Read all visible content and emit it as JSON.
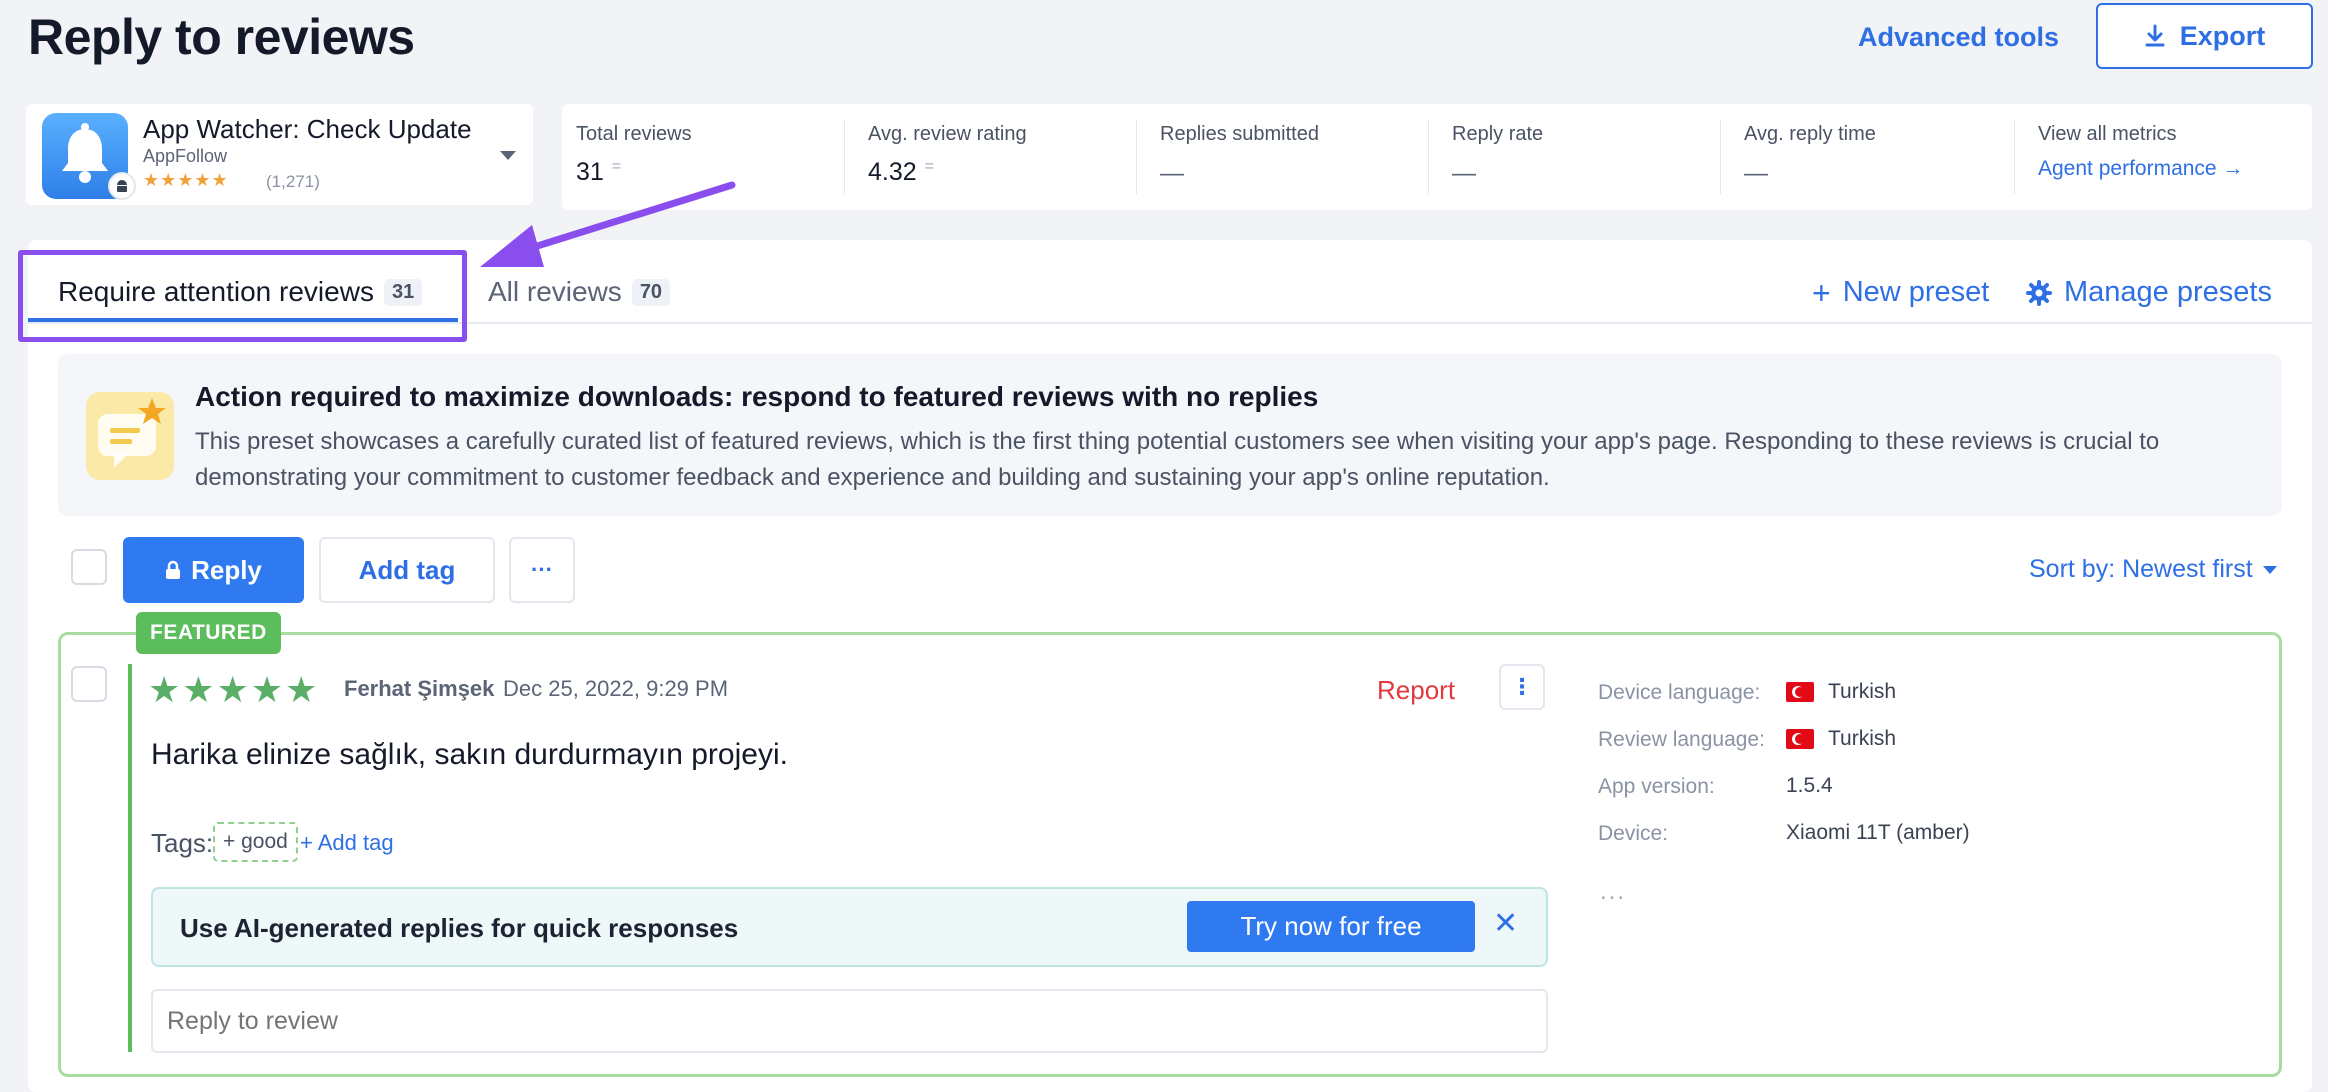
{
  "header": {
    "title": "Reply to reviews",
    "advanced_tools": "Advanced tools",
    "export_label": "Export"
  },
  "app": {
    "name": "App Watcher: Check Update",
    "developer": "AppFollow",
    "stars": "★★★★★",
    "rating_count": "(1,271)"
  },
  "metrics": [
    {
      "label": "Total reviews",
      "value": "31",
      "trend": "="
    },
    {
      "label": "Avg. review rating",
      "value": "4.32",
      "trend": "="
    },
    {
      "label": "Replies submitted",
      "value": "—"
    },
    {
      "label": "Reply rate",
      "value": "—"
    },
    {
      "label": "Avg. reply time",
      "value": "—"
    },
    {
      "label": "View all metrics",
      "link": "Agent performance →"
    }
  ],
  "tabs": [
    {
      "label": "Require attention reviews",
      "count": "31",
      "active": true
    },
    {
      "label": "All reviews",
      "count": "70",
      "active": false
    }
  ],
  "presets": {
    "new_preset": "New preset",
    "manage_presets": "Manage presets",
    "plus": "+"
  },
  "banner": {
    "title": "Action required to maximize downloads: respond to featured reviews with no replies",
    "text": "This preset showcases a carefully curated list of featured reviews, which is the first thing potential customers see when visiting your app's page. Responding to these reviews is crucial to demonstrating your commitment to customer feedback and experience and building and sustaining your app's online reputation."
  },
  "toolbar": {
    "reply_label": "Reply",
    "add_tag_label": "Add tag",
    "more_label": "···",
    "sort_label": "Sort by: Newest first"
  },
  "review": {
    "badge": "FEATURED",
    "stars": "★★★★★",
    "author": "Ferhat Şimşek",
    "date": "Dec 25, 2022, 9:29 PM",
    "report": "Report",
    "kebab": "⋮",
    "text": "Harika elinize sağlık, sakın durdurmayın projeyi.",
    "tags_label": "Tags:",
    "tags": [
      "+ good"
    ],
    "add_tag": "+ Add tag",
    "ai_prompt": "Use AI-generated replies for quick responses",
    "ai_button": "Try now for free",
    "ai_close": "✕",
    "reply_placeholder": "Reply to review",
    "meta": [
      {
        "label": "Device language:",
        "value": "Turkish",
        "flag": true
      },
      {
        "label": "Review language:",
        "value": "Turkish",
        "flag": true
      },
      {
        "label": "App version:",
        "value": "1.5.4",
        "flag": false
      },
      {
        "label": "Device:",
        "value": "Xiaomi 11T (amber)",
        "flag": false
      }
    ],
    "meta_more": "..."
  },
  "colors": {
    "accent": "#2f6fe4",
    "highlight": "#8a4dee",
    "featured": "#5bbd5b",
    "report": "#e0393e"
  }
}
